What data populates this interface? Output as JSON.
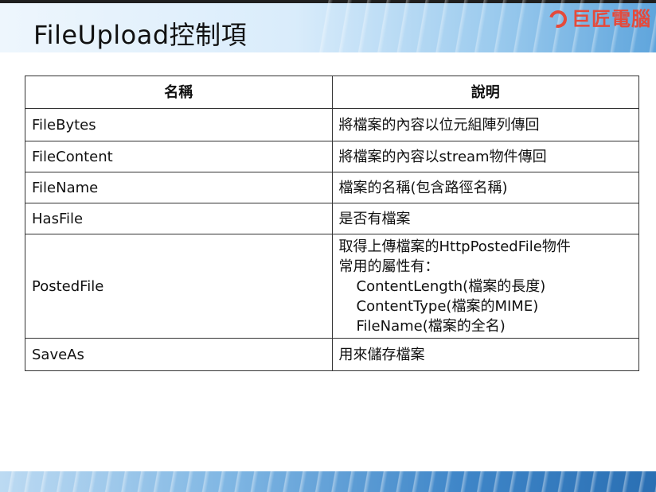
{
  "slide": {
    "title": "FileUpload控制項",
    "logo_text": "巨匠電腦",
    "logo_icon": "brand-g-icon",
    "accent_color": "#e54a3b",
    "header_color": "#5fa5dc"
  },
  "table": {
    "headers": [
      "名稱",
      "說明"
    ],
    "rows": [
      {
        "name": "FileBytes",
        "desc": [
          "將檔案的內容以位元組陣列傳回"
        ]
      },
      {
        "name": "FileContent",
        "desc": [
          "將檔案的內容以stream物件傳回"
        ]
      },
      {
        "name": "FileName",
        "desc": [
          "檔案的名稱(包含路徑名稱)"
        ]
      },
      {
        "name": "HasFile",
        "desc": [
          "是否有檔案"
        ]
      },
      {
        "name": "PostedFile",
        "desc": [
          "取得上傳檔案的HttpPostedFile物件",
          "常用的屬性有：",
          "ContentLength(檔案的長度)",
          "ContentType(檔案的MIME)",
          "FileName(檔案的全名)"
        ]
      },
      {
        "name": "SaveAs",
        "desc": [
          "用來儲存檔案"
        ]
      }
    ]
  }
}
